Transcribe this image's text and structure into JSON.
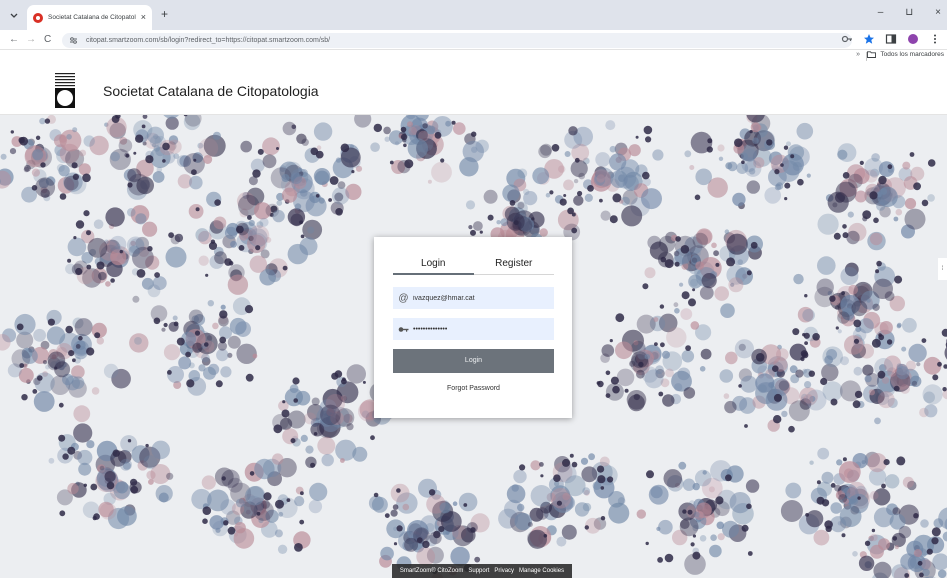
{
  "browser": {
    "tab_title": "Societat Catalana de Citopatolo",
    "close_glyph": "×",
    "new_tab_glyph": "+",
    "url": "citopat.smartzoom.com/sb/login?redirect_to=https://citopat.smartzoom.com/sb/",
    "bookmarks_folder": "Todos los marcadores",
    "bookmarks_more": "»",
    "window_controls": {
      "minimize": "–",
      "maximize": "⊔",
      "close": "×"
    },
    "nav": {
      "back": "←",
      "forward": "→",
      "reload": "C"
    },
    "icons": [
      "tune-icon",
      "key-icon",
      "star-icon",
      "side-panel-icon",
      "profile-icon",
      "menu-icon"
    ]
  },
  "site": {
    "title": "Societat Catalana de Citopatologia"
  },
  "login": {
    "tabs": [
      {
        "label": "Login",
        "active": true
      },
      {
        "label": "Register",
        "active": false
      }
    ],
    "email_value": "ivazquez@hmar.cat",
    "password_mask": "••••••••••••••",
    "submit_label": "Login",
    "forgot_label": "Forgot Password"
  },
  "footer": {
    "items": [
      "SmartZoom® CitoZoom",
      "Support",
      "Privacy",
      "Manage Cookies"
    ]
  },
  "colors": {
    "accent": "#666f78",
    "button": "#6c737b",
    "input_bg": "#e8f0fe",
    "stain_dark": "#2f2a48",
    "stain_blue": "#6f86a6",
    "stain_pink": "#b98a96"
  }
}
